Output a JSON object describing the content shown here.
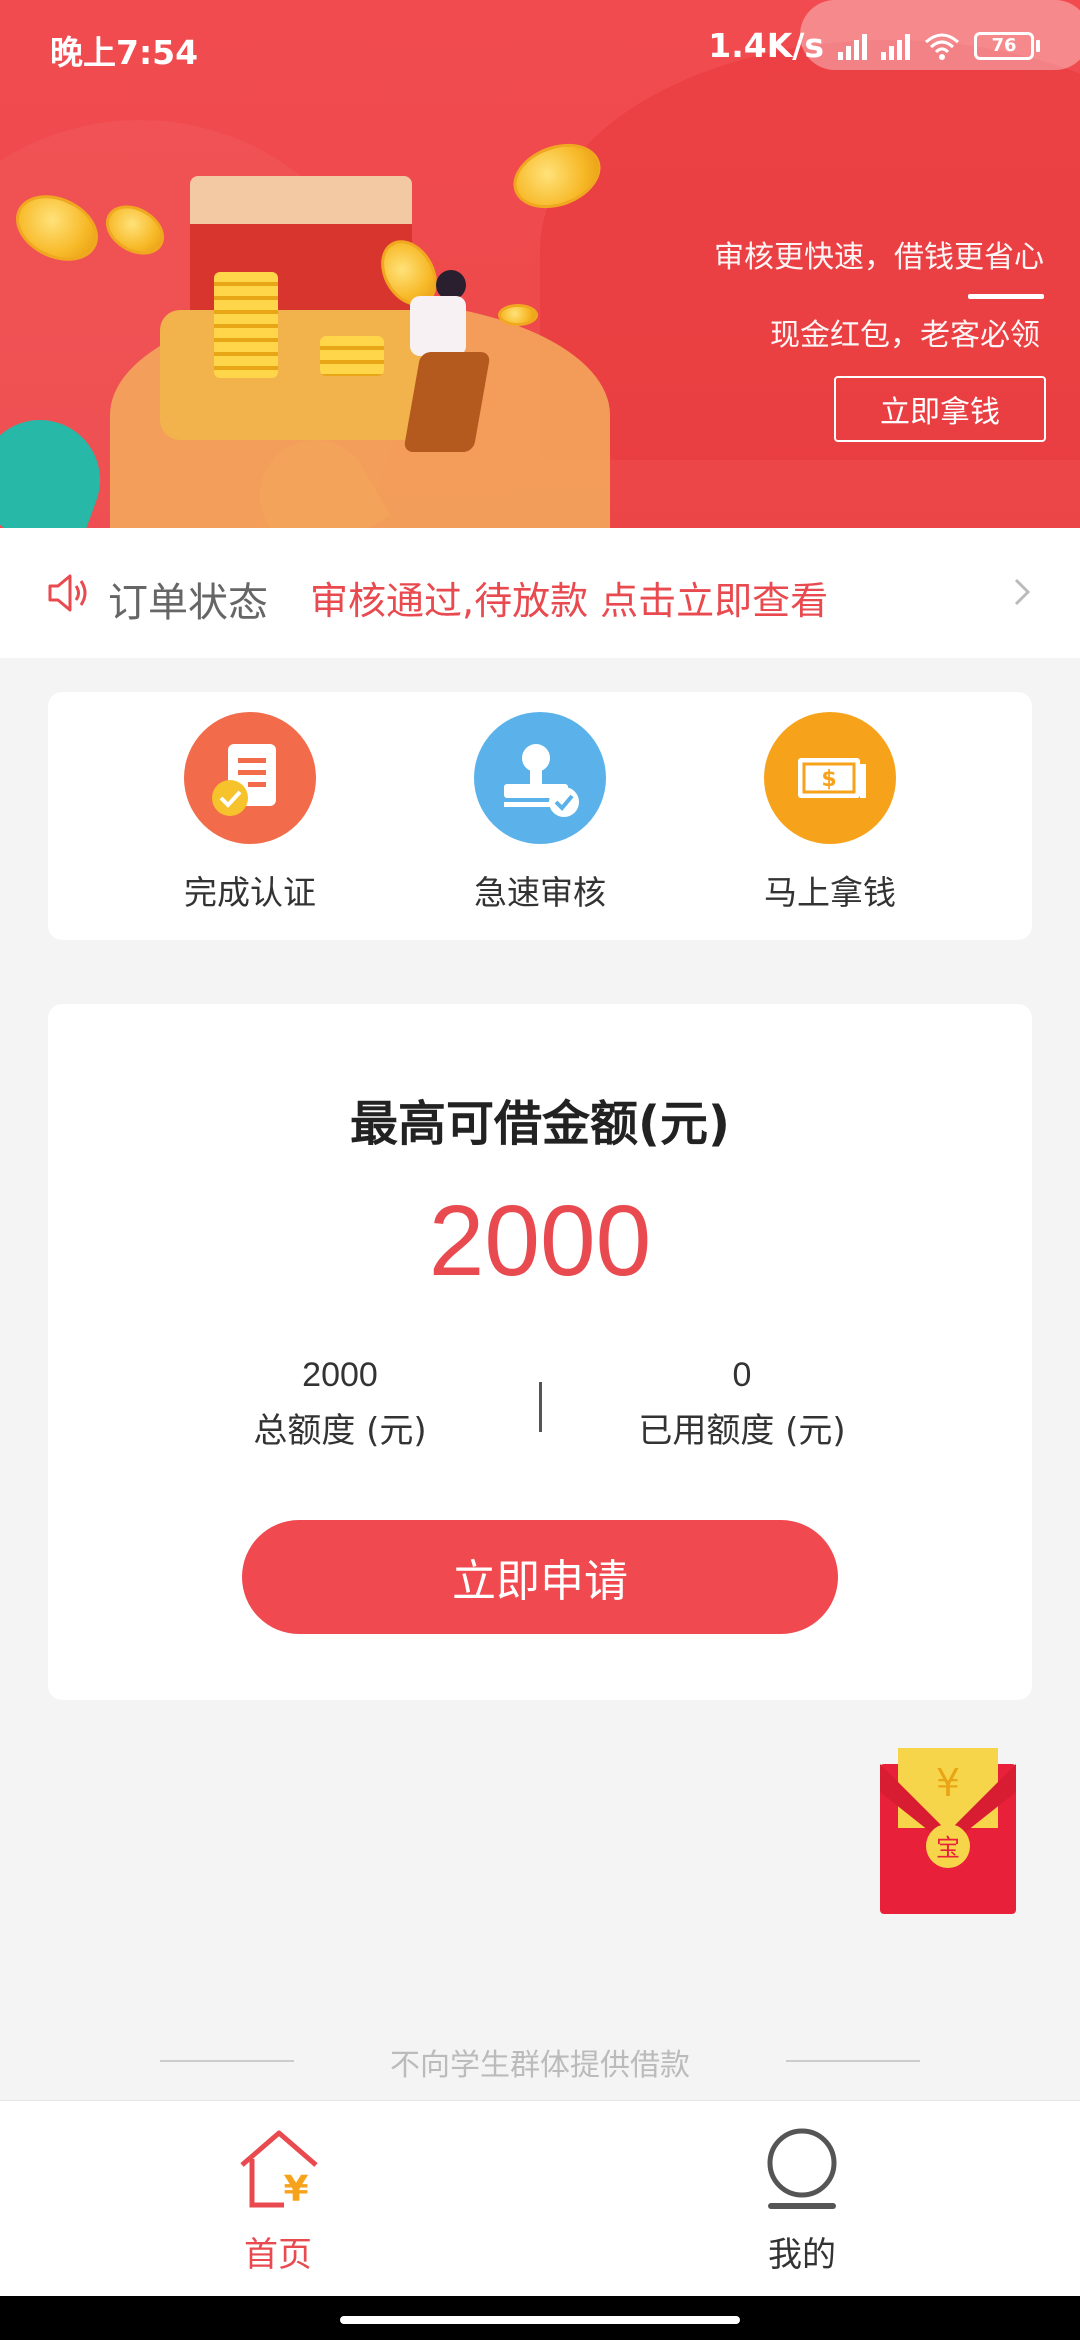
{
  "status_bar": {
    "time": "晚上7:54",
    "network_speed": "1.4K/s",
    "battery": "76"
  },
  "banner": {
    "slogan_line1": "审核更快速，借钱更省心",
    "slogan_line2": "现金红包，老客必领",
    "button_label": "立即拿钱"
  },
  "notice": {
    "label": "订单状态",
    "message": "审核通过,待放款 点击立即查看"
  },
  "steps": [
    {
      "label": "完成认证",
      "icon": "document-check-icon",
      "color": "#f26b4a"
    },
    {
      "label": "急速审核",
      "icon": "stamp-icon",
      "color": "#5bb2ea"
    },
    {
      "label": "马上拿钱",
      "icon": "cash-icon",
      "color": "#f7a21b"
    }
  ],
  "loan": {
    "title": "最高可借金额(元)",
    "amount": "2000",
    "total_value": "2000",
    "total_label": "总额度 (元)",
    "used_value": "0",
    "used_label": "已用额度 (元)",
    "apply_label": "立即申请"
  },
  "disclaimer": "不向学生群体提供借款",
  "tabbar": {
    "home_label": "首页",
    "mine_label": "我的"
  },
  "colors": {
    "accent": "#f04a50",
    "tab_active": "#e84a4f"
  }
}
